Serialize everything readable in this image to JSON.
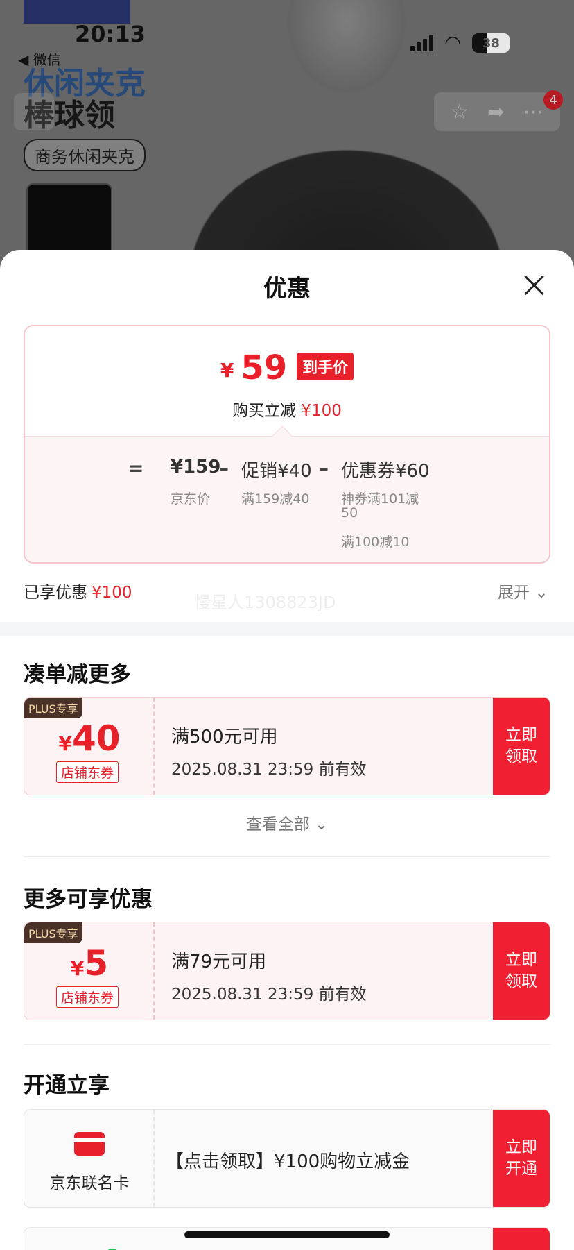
{
  "status_bar": {
    "time": "20:13",
    "back_app": "◀ 微信",
    "battery": "38"
  },
  "background": {
    "title_line1": "休闲夹克",
    "title_line2": "棒球领",
    "category_tag": "商务休闲夹克",
    "cart_badge": "4"
  },
  "sheet": {
    "title": "优惠",
    "price": {
      "yen": "¥",
      "final_price": "59",
      "final_tag": "到手价",
      "reduce_label": "购买立减",
      "reduce_amount": "¥100"
    },
    "breakdown": {
      "equals": "=",
      "minus": "–",
      "jd_price": "¥159",
      "jd_price_label": "京东价",
      "promo": "促销¥40",
      "promo_note": "满159减40",
      "coupon": "优惠券¥60",
      "coupon_note_1a": "神券满101减",
      "coupon_note_1b": "50",
      "coupon_note_2": "满100减10"
    },
    "enjoyed_label": "已享优惠",
    "enjoyed_amount": "¥100",
    "expand_label": "展开",
    "watermark": "慢星人1308823JD"
  },
  "section_more": {
    "title": "凑单减更多",
    "coupon": {
      "plus_label": "PLUS专享",
      "yen": "¥",
      "amount": "40",
      "type": "店铺东券",
      "condition": "满500元可用",
      "expiry": "2025.08.31 23:59 前有效",
      "btn_line1": "立即",
      "btn_line2": "领取"
    },
    "view_all": "查看全部"
  },
  "section_extra": {
    "title": "更多可享优惠",
    "coupon": {
      "plus_label": "PLUS专享",
      "yen": "¥",
      "amount": "5",
      "type": "店铺东券",
      "condition": "满79元可用",
      "expiry": "2025.08.31 23:59 前有效",
      "btn_line1": "立即",
      "btn_line2": "领取"
    }
  },
  "section_open": {
    "title": "开通立享",
    "card": {
      "name": "京东联名卡",
      "desc": "【点击领取】¥100购物立减金",
      "btn_line1": "立即",
      "btn_line2": "开通"
    }
  },
  "colors": {
    "accent": "#e8202a",
    "button": "#f01f31",
    "plus_bg": "#4a3228"
  }
}
